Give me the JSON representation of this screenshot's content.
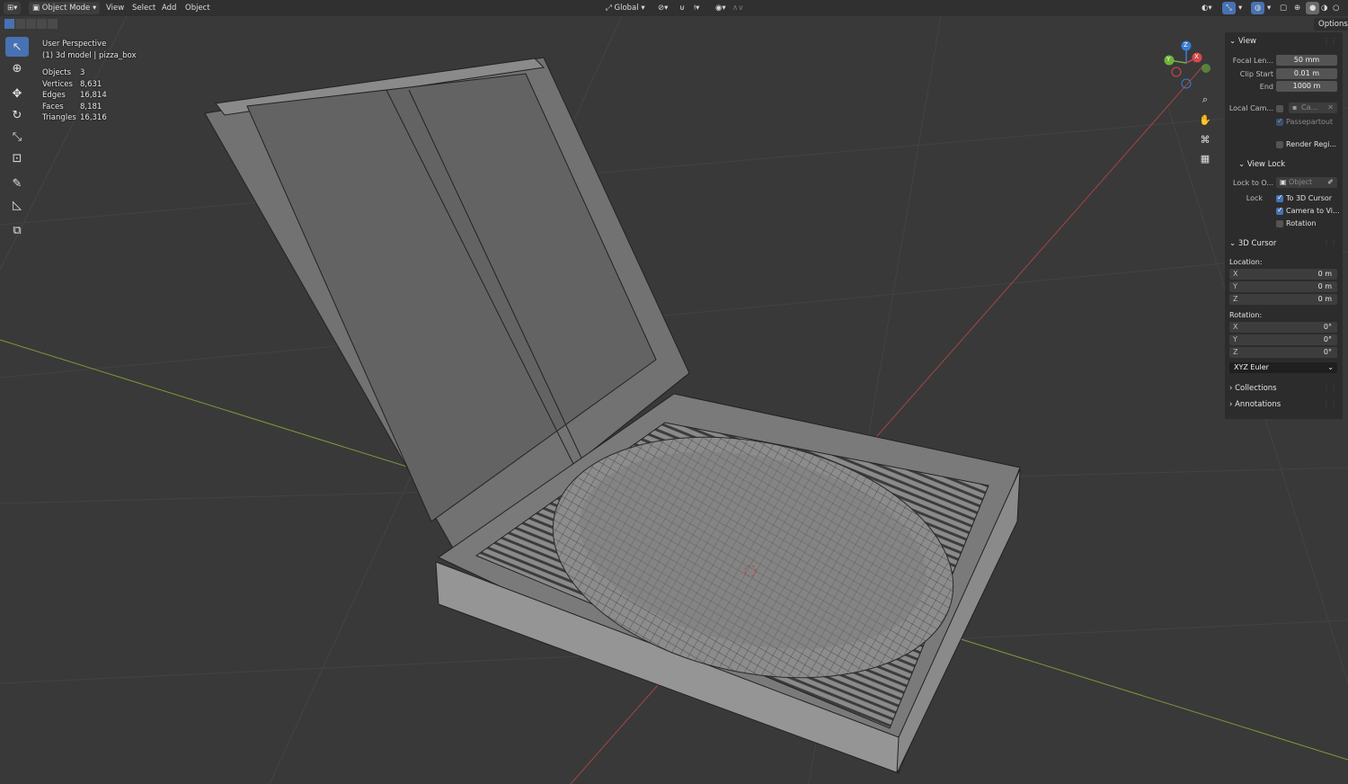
{
  "header": {
    "mode": "Object Mode",
    "menus": [
      "View",
      "Select",
      "Add",
      "Object"
    ],
    "orientation": "Global"
  },
  "overlay": {
    "perspective": "User Perspective",
    "object_path": "(1) 3d model | pizza_box",
    "stats": [
      {
        "label": "Objects",
        "value": "3"
      },
      {
        "label": "Vertices",
        "value": "8,631"
      },
      {
        "label": "Edges",
        "value": "16,814"
      },
      {
        "label": "Faces",
        "value": "8,181"
      },
      {
        "label": "Triangles",
        "value": "16,316"
      }
    ]
  },
  "gizmo": {
    "x": "X",
    "y": "Y",
    "z": "Z"
  },
  "sidebar": {
    "options": "Options",
    "view": {
      "title": "View",
      "focal_label": "Focal Len...",
      "focal_value": "50 mm",
      "clip_start_label": "Clip Start",
      "clip_start_value": "0.01 m",
      "end_label": "End",
      "end_value": "1000 m",
      "local_cam_label": "Local Cam...",
      "local_cam_value": "Ca...",
      "passepartout": "Passepartout",
      "render_region": "Render Regi..."
    },
    "view_lock": {
      "title": "View Lock",
      "lock_to_label": "Lock to O...",
      "lock_to_value": "Object",
      "lock_label": "Lock",
      "to_cursor": "To 3D Cursor",
      "camera_to_view": "Camera to Vi...",
      "rotation": "Rotation"
    },
    "cursor": {
      "title": "3D Cursor",
      "location_label": "Location:",
      "loc": [
        {
          "axis": "X",
          "value": "0 m"
        },
        {
          "axis": "Y",
          "value": "0 m"
        },
        {
          "axis": "Z",
          "value": "0 m"
        }
      ],
      "rotation_label": "Rotation:",
      "rot": [
        {
          "axis": "X",
          "value": "0°"
        },
        {
          "axis": "Y",
          "value": "0°"
        },
        {
          "axis": "Z",
          "value": "0°"
        }
      ],
      "rotation_mode": "XYZ Euler"
    },
    "collections": "Collections",
    "annotations": "Annotations"
  }
}
